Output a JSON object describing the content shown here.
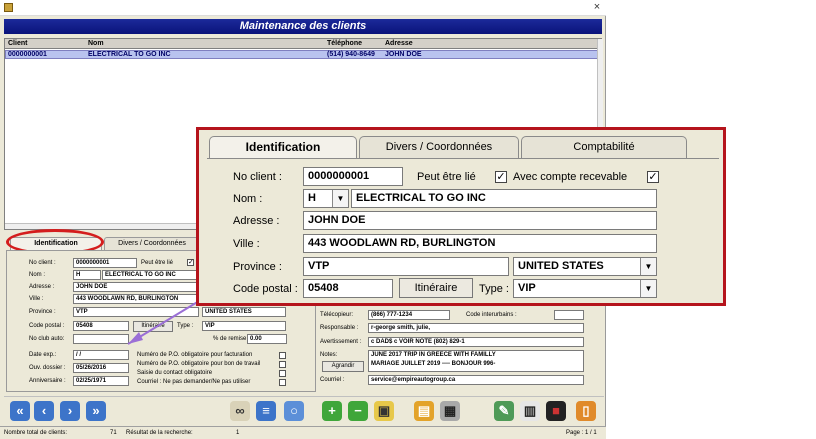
{
  "window": {
    "title_banner": "Maintenance des clients",
    "close_glyph": "×"
  },
  "grid": {
    "headers": {
      "client": "Client",
      "nom": "Nom",
      "telephone": "Téléphone",
      "adresse": "Adresse"
    },
    "rows": [
      {
        "client": "0000000001",
        "nom": "ELECTRICAL TO GO INC",
        "telephone": "(514) 940-8649",
        "adresse": "JOHN DOE"
      }
    ]
  },
  "tabs": {
    "identification": "Identification",
    "divers": "Divers / Coordonnées",
    "comptabilite": "Comptabilité"
  },
  "form": {
    "no_client_label": "No client :",
    "no_client": "0000000001",
    "peut_etre_lie_label": "Peut être lié",
    "peut_etre_lie_checked": "✓",
    "avec_compte_label": "Avec compte recevable",
    "avec_compte_checked": "✓",
    "nom_label": "Nom :",
    "nom_prefix": "H",
    "nom": "ELECTRICAL TO GO INC",
    "adresse_label": "Adresse :",
    "adresse": "JOHN DOE",
    "ville_label": "Ville :",
    "ville": "443 WOODLAWN RD, BURLINGTON",
    "province_label": "Province :",
    "province": "VTP",
    "pays": "UNITED STATES",
    "code_postal_label": "Code postal :",
    "code_postal": "05408",
    "itineraire_button": "Itinéraire",
    "type_label": "Type :",
    "type": "VIP",
    "no_club_label": "No club auto:",
    "pct_remise_label": "% de remise :",
    "pct_remise": "0.00",
    "date_exp_label": "Date exp.:",
    "date_exp": "/ /",
    "ouv_dossier_label": "Ouv. dossier :",
    "ouv_dossier": "05/26/2016",
    "anniversaire_label": "Anniversaire :",
    "anniversaire": "02/25/1971",
    "po_facturation_label": "Numéro de P.O. obligatoire pour facturation",
    "po_bon_label": "Numéro de P.O. obligatoire pour bon de travail",
    "saisie_contact_label": "Saisie du contact obligatoire",
    "courriel_ne_pas_label": "Courriel : Ne pas demander/Ne pas utiliser",
    "telecopieur_label": "Télécopieur:",
    "telecopieur": "(866) 777-1234",
    "code_interurbains_label": "Code interurbains :",
    "responsable_label": "Responsable :",
    "responsable": "r-george smith, julie,",
    "avertissement_label": "Avertissement :",
    "avertissement": "c DAD$ c VOIR NOTE (802) 829-1",
    "notes_label": "Notes:",
    "notes_line1": "JUNE 2017 TRIP IN GREECE WITH FAMILLY",
    "notes_line2": "MARIAGE JUILLET 2019 ---- BONJOUR 996-",
    "agrandir_button": "Agrandir",
    "courriel_label": "Courriel :",
    "courriel": "service@empireautogroup.ca"
  },
  "toolbar": {
    "icons": [
      "first-record-icon",
      "previous-record-icon",
      "next-record-icon",
      "last-record-icon",
      "search-binoculars-icon",
      "printer-list-icon",
      "magnifier-icon",
      "add-icon",
      "remove-icon",
      "save-icon",
      "folders-icon",
      "print-icon",
      "notebook-icon",
      "documents-icon",
      "briefcase-icon",
      "exit-icon"
    ]
  },
  "status": {
    "total_label": "Nombre total de clients:",
    "total": "71",
    "result_label": "Résultat de la recherche:",
    "result": "1",
    "page": "Page : 1 / 1"
  },
  "colors": {
    "banner": "#0a137a",
    "highlight_ring": "#d41d1d",
    "zoom_border": "#b5141c",
    "arrow": "#9b6fd6",
    "row_select": "#b9c3ef"
  }
}
